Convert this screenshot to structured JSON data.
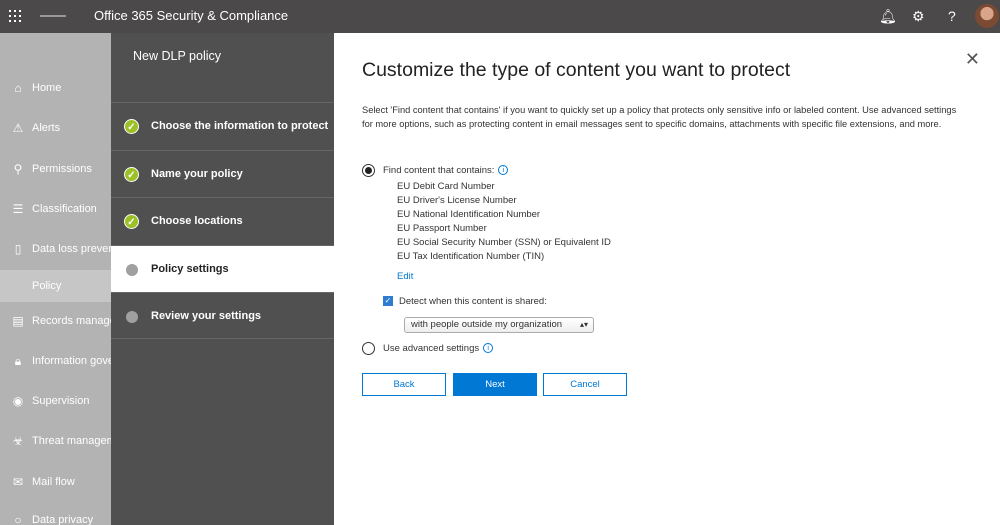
{
  "header": {
    "title": "Office 365 Security & Compliance"
  },
  "nav": {
    "items": [
      {
        "label": "Home",
        "icon": "home-icon"
      },
      {
        "label": "Alerts",
        "icon": "alert-icon"
      },
      {
        "label": "Permissions",
        "icon": "permissions-icon"
      },
      {
        "label": "Classification",
        "icon": "classification-icon"
      },
      {
        "label": "Data loss prevention",
        "icon": "lock-document-icon"
      },
      {
        "label": "Policy"
      },
      {
        "label": "Records management",
        "icon": "records-icon"
      },
      {
        "label": "Information governance",
        "icon": "lock-icon"
      },
      {
        "label": "Supervision",
        "icon": "eye-icon"
      },
      {
        "label": "Threat management",
        "icon": "biohazard-icon"
      },
      {
        "label": "Mail flow",
        "icon": "mail-icon"
      },
      {
        "label": "Data privacy",
        "icon": "privacy-icon"
      }
    ]
  },
  "wizard": {
    "title": "New DLP policy",
    "steps": [
      {
        "label": "Choose the information to protect",
        "status": "done"
      },
      {
        "label": "Name your policy",
        "status": "done"
      },
      {
        "label": "Choose locations",
        "status": "done"
      },
      {
        "label": "Policy settings",
        "status": "current"
      },
      {
        "label": "Review your settings",
        "status": "pending"
      }
    ]
  },
  "main": {
    "title": "Customize the type of content you want to protect",
    "intro": "Select 'Find content that contains' if you want to quickly set up a policy that protects only sensitive info or labeled content. Use advanced settings for more options, such as protecting content in email messages sent to specific domains, attachments with specific file extensions, and more.",
    "option_find": "Find content that contains:",
    "sensitive_types": [
      "EU Debit Card Number",
      "EU Driver's License Number",
      "EU National Identification Number",
      "EU Passport Number",
      "EU Social Security Number (SSN) or Equivalent ID",
      "EU Tax Identification Number (TIN)"
    ],
    "edit": "Edit",
    "detect_label": "Detect when this content is shared:",
    "detect_checked": true,
    "share_select": "with people outside my organization",
    "option_advanced": "Use advanced settings",
    "selected_option": "find",
    "back": "Back",
    "next": "Next",
    "cancel": "Cancel"
  }
}
